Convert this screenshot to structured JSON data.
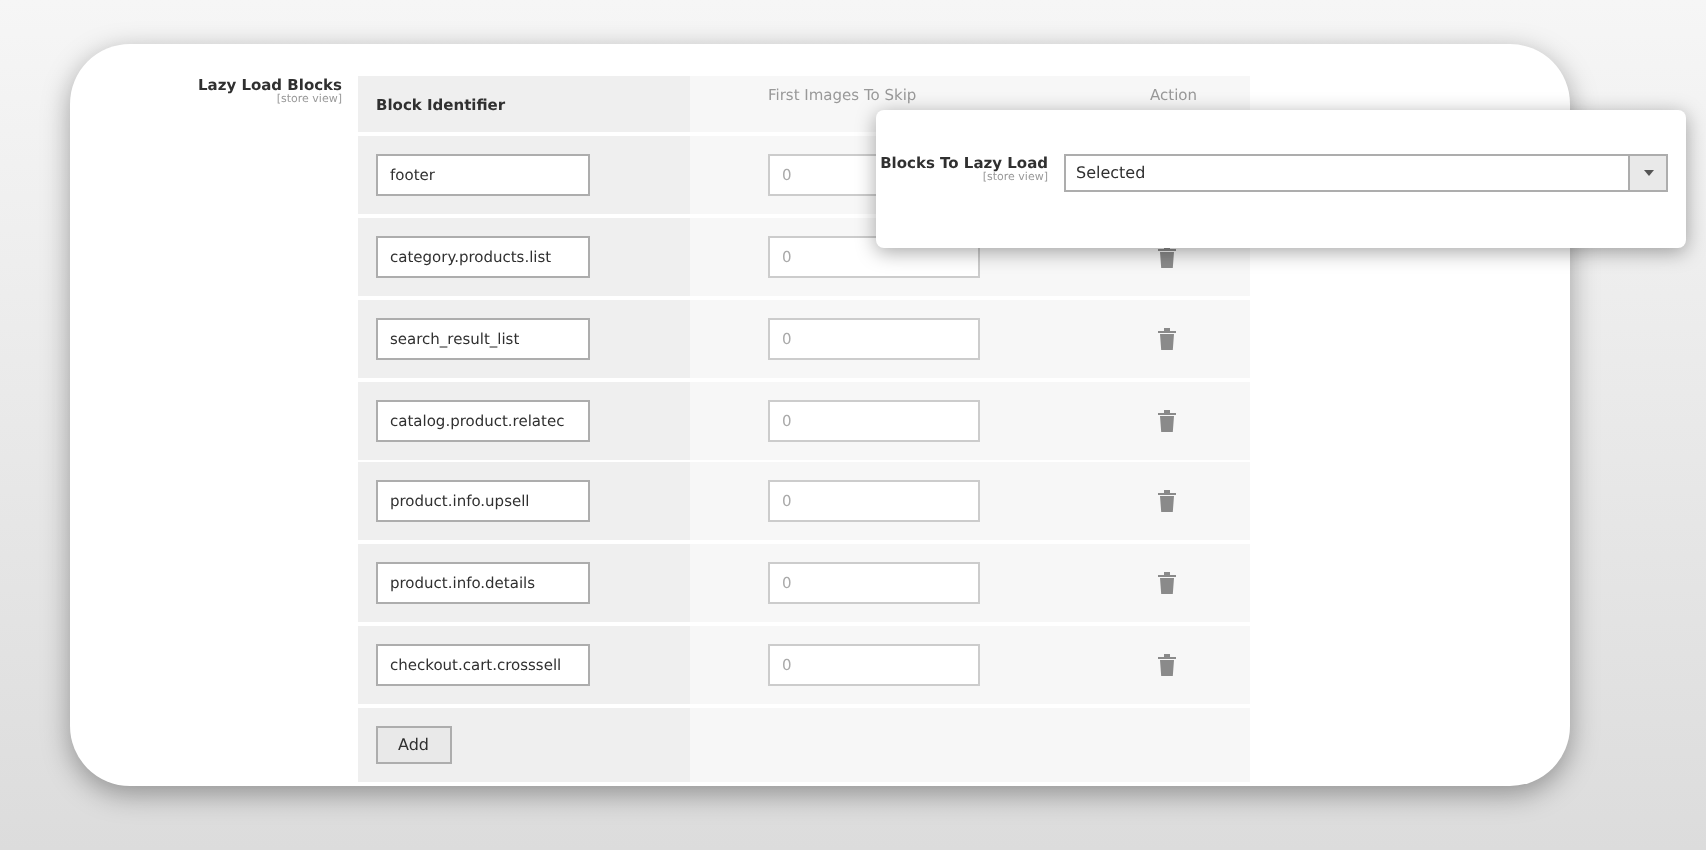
{
  "section": {
    "label": "Lazy Load Blocks",
    "scope": "[store view]"
  },
  "table": {
    "columns": [
      "Block Identifier",
      "First Images To Skip",
      "Action"
    ],
    "rows": [
      {
        "identifier": "footer",
        "skip": "0"
      },
      {
        "identifier": "category.products.list",
        "skip": "0"
      },
      {
        "identifier": "search_result_list",
        "skip": "0"
      },
      {
        "identifier": "catalog.product.relatec",
        "skip": "0"
      },
      {
        "identifier": "product.info.upsell",
        "skip": "0"
      },
      {
        "identifier": "product.info.details",
        "skip": "0"
      },
      {
        "identifier": "checkout.cart.crosssell",
        "skip": "0"
      }
    ],
    "add_button": "Add"
  },
  "popup": {
    "label": "Blocks To Lazy Load",
    "scope": "[store view]",
    "value": "Selected"
  }
}
